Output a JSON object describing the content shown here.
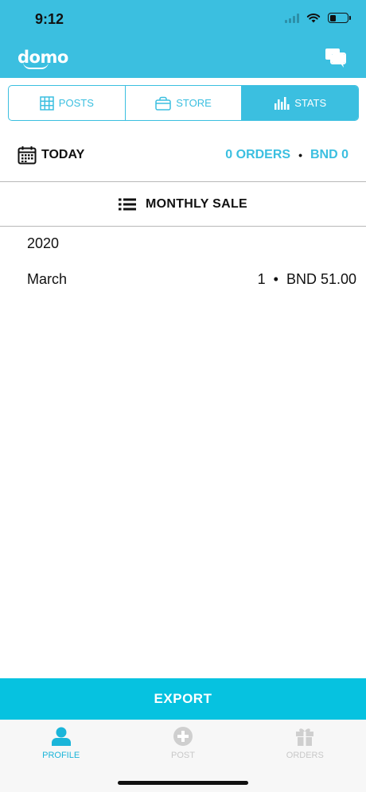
{
  "status_bar": {
    "time": "9:12"
  },
  "header": {
    "logo_text": "domo",
    "accent_color": "#3bbfe0"
  },
  "tabs": [
    {
      "label": "POSTS",
      "icon": "grid-icon",
      "active": false
    },
    {
      "label": "STORE",
      "icon": "bag-icon",
      "active": false
    },
    {
      "label": "STATS",
      "icon": "bar-chart-icon",
      "active": true
    }
  ],
  "today": {
    "label": "TODAY",
    "orders": "0 ORDERS",
    "separator": "•",
    "amount": "BND 0"
  },
  "section": {
    "title": "MONTHLY SALE",
    "icon": "list-icon"
  },
  "sales": {
    "year": "2020",
    "rows": [
      {
        "month": "March",
        "count": "1",
        "separator": "•",
        "amount": "BND 51.00"
      }
    ]
  },
  "export_label": "EXPORT",
  "tabbar": [
    {
      "label": "PROFILE",
      "icon": "person-icon",
      "active": true
    },
    {
      "label": "POST",
      "icon": "plus-circle-icon",
      "active": false
    },
    {
      "label": "ORDERS",
      "icon": "gift-icon",
      "active": false
    }
  ]
}
